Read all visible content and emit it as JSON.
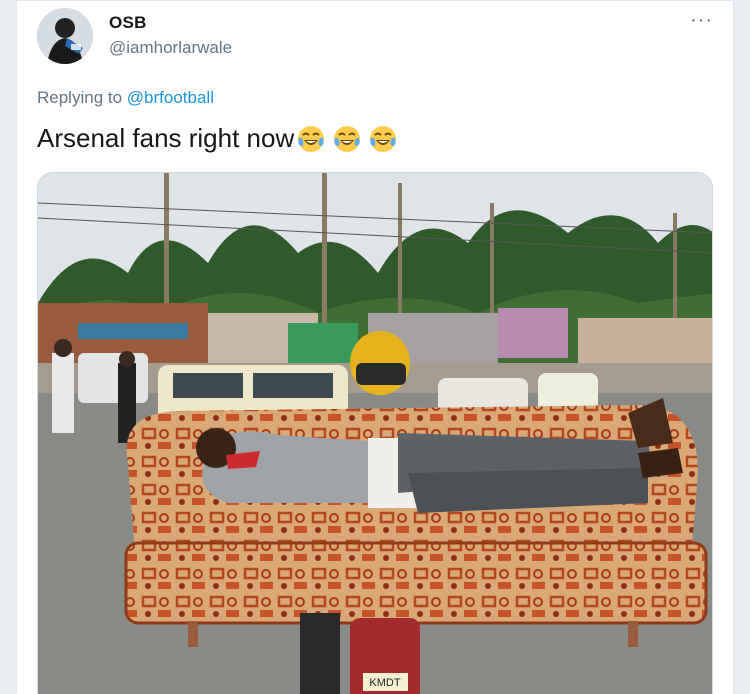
{
  "tweet": {
    "display_name": "OSB",
    "handle": "@iamhorlarwale",
    "replying_prefix": "Replying to",
    "replying_to": "@brfootball",
    "text": "Arsenal fans right now",
    "emojis": [
      "face-with-tears-of-joy",
      "face-with-tears-of-joy",
      "face-with-tears-of-joy"
    ],
    "more_icon": "ellipsis-icon",
    "more_label": "···"
  },
  "media": {
    "description_icon": "photo",
    "plate_text": "KMDT"
  },
  "colors": {
    "link": "#1b95e0",
    "secondary_text": "#657786",
    "primary_text": "#14171a",
    "background": "#e6ecf0"
  }
}
